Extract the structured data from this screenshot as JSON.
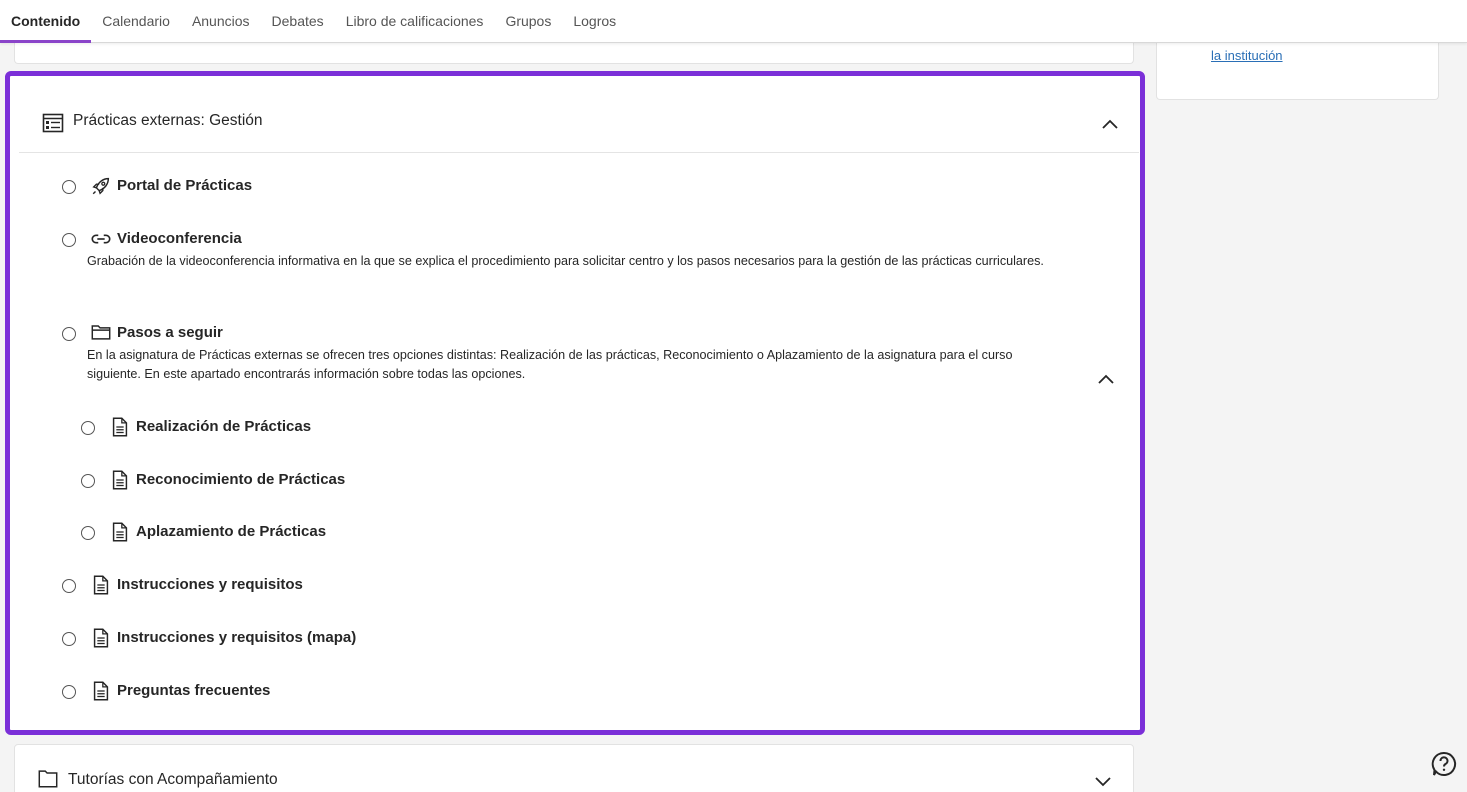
{
  "nav": {
    "tabs": [
      {
        "label": "Contenido",
        "active": true
      },
      {
        "label": "Calendario"
      },
      {
        "label": "Anuncios"
      },
      {
        "label": "Debates"
      },
      {
        "label": "Libro de calificaciones"
      },
      {
        "label": "Grupos"
      },
      {
        "label": "Logros"
      }
    ]
  },
  "side_panel": {
    "link": "la institución"
  },
  "module": {
    "title": "Prácticas externas: Gestión",
    "items": [
      {
        "title": "Portal de Prácticas",
        "icon": "rocket-icon"
      },
      {
        "title": "Videoconferencia",
        "icon": "link-icon",
        "description": "Grabación de la videoconferencia informativa en la que se explica el procedimiento para solicitar centro y los pasos necesarios para la gestión de las prácticas curriculares."
      },
      {
        "title": "Pasos a seguir",
        "icon": "folder-icon",
        "description": "En la asignatura de Prácticas externas se ofrecen tres opciones distintas: Realización de las prácticas, Reconocimiento o Aplazamiento de la asignatura para el curso siguiente. En este apartado encontrarás información sobre todas las opciones.",
        "children": [
          {
            "title": "Realización de Prácticas",
            "icon": "document-icon"
          },
          {
            "title": "Reconocimiento de Prácticas",
            "icon": "document-icon"
          },
          {
            "title": "Aplazamiento de Prácticas",
            "icon": "document-icon"
          }
        ]
      },
      {
        "title": "Instrucciones y requisitos",
        "icon": "document-icon"
      },
      {
        "title": "Instrucciones y requisitos (mapa)",
        "icon": "document-icon"
      },
      {
        "title": "Preguntas frecuentes",
        "icon": "document-icon"
      }
    ]
  },
  "next_module": {
    "title": "Tutorías con Acompañamiento",
    "icon": "folder-icon"
  },
  "colors": {
    "accent": "#7b2fd8",
    "tab_underline": "#8a44c9",
    "link": "#2a6fb6"
  }
}
